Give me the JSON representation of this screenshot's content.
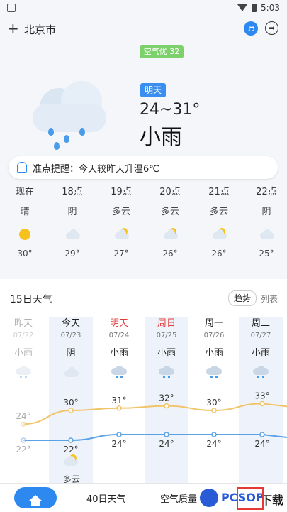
{
  "status": {
    "time": "5:03"
  },
  "header": {
    "plus_label": "+",
    "city": "北京市"
  },
  "aqi": "空气优 32",
  "tomorrow": {
    "badge": "明天",
    "temp_range": "24~31°",
    "condition": "小雨"
  },
  "reminder": {
    "text": "准点提醒：今天较昨天升温6℃"
  },
  "hourly": [
    {
      "time": "现在",
      "cond": "晴",
      "icon": "sun-icon",
      "temp": "30°"
    },
    {
      "time": "18点",
      "cond": "阴",
      "icon": "cloud-icon",
      "temp": "29°"
    },
    {
      "time": "19点",
      "cond": "多云",
      "icon": "partly-cloudy-icon",
      "temp": "27°"
    },
    {
      "time": "20点",
      "cond": "多云",
      "icon": "partly-cloudy-icon",
      "temp": "26°"
    },
    {
      "time": "21点",
      "cond": "多云",
      "icon": "partly-cloudy-icon",
      "temp": "26°"
    },
    {
      "time": "22点",
      "cond": "阴",
      "icon": "cloud-icon",
      "temp": "25°"
    }
  ],
  "forecast": {
    "title": "15日天气",
    "trend_label": "趋势",
    "list_label": "列表",
    "days": [
      {
        "name": "昨天",
        "date": "07/22",
        "cond": "小雨",
        "high": "",
        "low": "",
        "night_cond": ""
      },
      {
        "name": "今天",
        "date": "07/23",
        "cond": "阴",
        "high": "30°",
        "low": "22°",
        "night_cond": "多云"
      },
      {
        "name": "明天",
        "date": "07/24",
        "cond": "小雨",
        "high": "31°",
        "low": "24°",
        "night_cond": ""
      },
      {
        "name": "周日",
        "date": "07/25",
        "cond": "小雨",
        "high": "32°",
        "low": "24°",
        "night_cond": ""
      },
      {
        "name": "周一",
        "date": "07/26",
        "cond": "小雨",
        "high": "30°",
        "low": "24°",
        "night_cond": ""
      },
      {
        "name": "周二",
        "date": "07/27",
        "cond": "小雨",
        "high": "33°",
        "low": "24°",
        "night_cond": ""
      }
    ],
    "yesterday_high": "24°",
    "yesterday_low": "22°"
  },
  "chart_data": {
    "type": "line",
    "categories": [
      "昨天",
      "今天",
      "明天",
      "周日",
      "周一",
      "周二"
    ],
    "series": [
      {
        "values": [
          24,
          30,
          31,
          32,
          30,
          33
        ]
      },
      {
        "values": [
          22,
          22,
          24,
          24,
          24,
          24
        ]
      }
    ]
  },
  "bottom_nav": {
    "tab1": "40日天气",
    "tab2": "空气质量"
  },
  "watermark": {
    "brand": "PCSOF",
    "suffix": "下载"
  },
  "colors": {
    "accent": "#2d89f0",
    "high_line": "#f2c46a",
    "low_line": "#5aa2e6",
    "highlight_red": "#e53935"
  }
}
